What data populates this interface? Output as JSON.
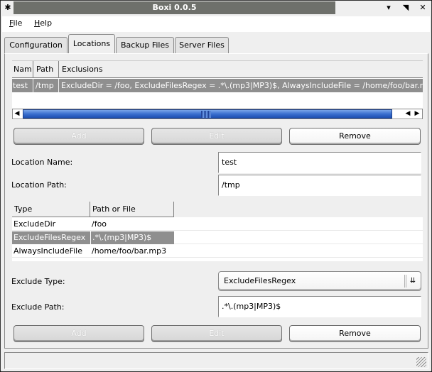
{
  "window": {
    "title": "Boxi 0.0.5",
    "icons": {
      "pin": "pin-icon",
      "minimize": "minimize-icon",
      "maximize": "maximize-icon",
      "close": "close-icon"
    }
  },
  "menu": {
    "items": [
      {
        "label": "File",
        "mnemonic": "F",
        "rest": "ile"
      },
      {
        "label": "Help",
        "mnemonic": "H",
        "rest": "elp"
      }
    ]
  },
  "tabs": [
    {
      "label": "Configuration",
      "active": false
    },
    {
      "label": "Locations",
      "active": true
    },
    {
      "label": "Backup Files",
      "active": false
    },
    {
      "label": "Server Files",
      "active": false
    }
  ],
  "locations_table": {
    "columns": [
      "Nam",
      "Path",
      "Exclusions"
    ],
    "rows": [
      {
        "name": "test",
        "path": "/tmp",
        "exclusions": "ExcludeDir = /foo, ExcludeFilesRegex = .*\\.(mp3|MP3)$, AlwaysIncludeFile = /home/foo/bar.mp",
        "selected": true
      }
    ]
  },
  "location_buttons": {
    "add": "Add",
    "edit": "Edit",
    "remove": "Remove"
  },
  "location_form": {
    "name_label": "Location Name:",
    "name_value": "test",
    "path_label": "Location Path:",
    "path_value": "/tmp"
  },
  "exclusions_table": {
    "columns": [
      "Type",
      "Path or File"
    ],
    "rows": [
      {
        "type": "ExcludeDir",
        "path": "/foo",
        "selected": false
      },
      {
        "type": "ExcludeFilesRegex",
        "path": ".*\\.(mp3|MP3)$",
        "selected": true
      },
      {
        "type": "AlwaysIncludeFile",
        "path": "/home/foo/bar.mp3",
        "selected": false
      }
    ]
  },
  "exclude_form": {
    "type_label": "Exclude Type:",
    "type_value": "ExcludeFilesRegex",
    "path_label": "Exclude Path:",
    "path_value": ".*\\.(mp3|MP3)$"
  },
  "exclude_buttons": {
    "add": "Add",
    "edit": "Edit",
    "remove": "Remove"
  },
  "status": {
    "text": ""
  }
}
